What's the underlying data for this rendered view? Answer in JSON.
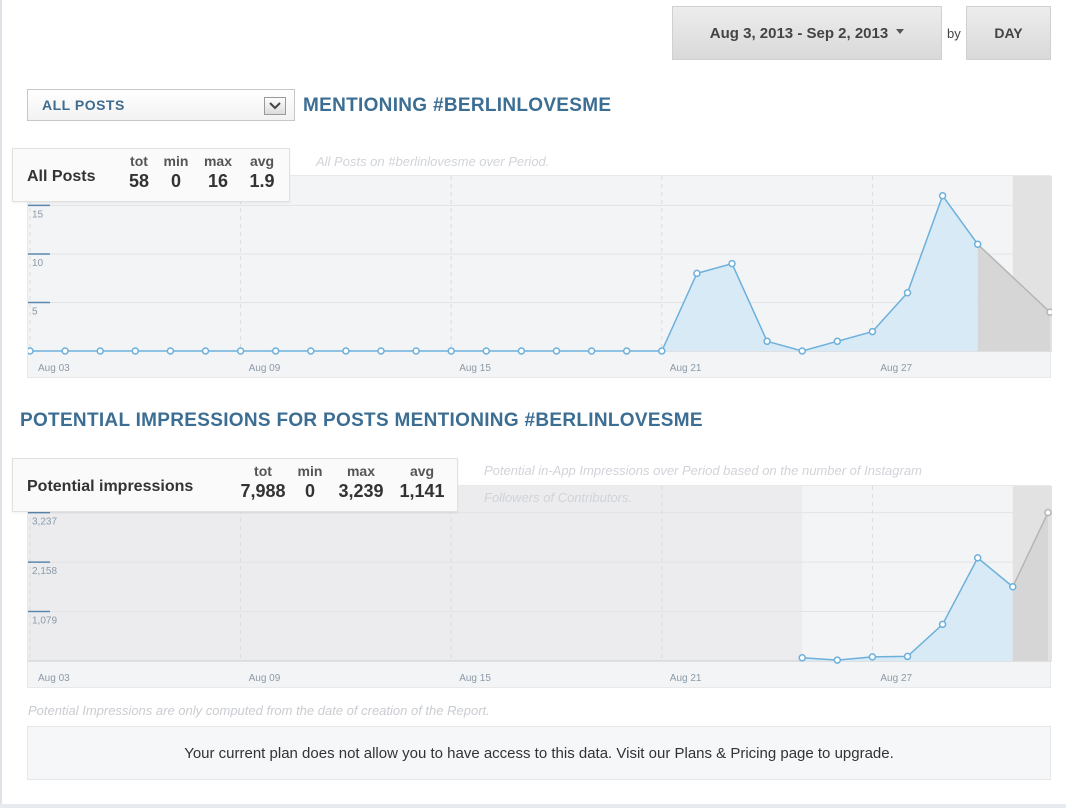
{
  "toolbar": {
    "date_range": "Aug 3, 2013 - Sep 2, 2013",
    "by_label": "by",
    "granularity": "DAY"
  },
  "filter": {
    "selected": "ALL POSTS",
    "heading": "MENTIONING #BERLINLOVESME"
  },
  "posts_panel": {
    "stats_name": "All Posts",
    "headers": [
      "tot",
      "min",
      "max",
      "avg"
    ],
    "values": [
      "58",
      "0",
      "16",
      "1.9"
    ],
    "subtitle": "All Posts on #berlinlovesme over Period."
  },
  "impressions_panel": {
    "heading": "POTENTIAL IMPRESSIONS FOR POSTS MENTIONING #BERLINLOVESME",
    "stats_name": "Potential impressions",
    "headers": [
      "tot",
      "min",
      "max",
      "avg"
    ],
    "values": [
      "7,988",
      "0",
      "3,239",
      "1,141"
    ],
    "subtitle_line1": "Potential in-App Impressions over Period based on the number of Instagram",
    "subtitle_line2": "Followers of Contributors."
  },
  "footer": {
    "note": "Potential Impressions are only computed from the date of creation of the Report.",
    "plan_message": "Your current plan does not allow you to have access to this data. Visit our Plans & Pricing page to upgrade."
  },
  "colors": {
    "line": "#6cb0db",
    "fill": "#d8eaf6",
    "projection": "#b5b5b5",
    "accent": "#3c6e94"
  },
  "chart_data": [
    {
      "type": "area",
      "x_ticks": [
        "Aug 03",
        "Aug 09",
        "Aug 15",
        "Aug 21",
        "Aug 27"
      ],
      "y_ticks": [
        "5",
        "10",
        "15"
      ],
      "ylim": [
        0,
        17
      ],
      "grid": true,
      "x": [
        "Aug 03",
        "Aug 04",
        "Aug 05",
        "Aug 06",
        "Aug 07",
        "Aug 08",
        "Aug 09",
        "Aug 10",
        "Aug 11",
        "Aug 12",
        "Aug 13",
        "Aug 14",
        "Aug 15",
        "Aug 16",
        "Aug 17",
        "Aug 18",
        "Aug 19",
        "Aug 20",
        "Aug 21",
        "Aug 22",
        "Aug 23",
        "Aug 24",
        "Aug 25",
        "Aug 26",
        "Aug 27",
        "Aug 28",
        "Aug 29",
        "Aug 30",
        "Aug 31",
        "Sep 01"
      ],
      "values": [
        0,
        0,
        0,
        0,
        0,
        0,
        0,
        0,
        0,
        0,
        0,
        0,
        0,
        0,
        0,
        0,
        0,
        0,
        0,
        8,
        9,
        1,
        0,
        1,
        2,
        6,
        16,
        11,
        null,
        4
      ],
      "projection_from": 27
    },
    {
      "type": "area",
      "x_ticks": [
        "Aug 03",
        "Aug 09",
        "Aug 15",
        "Aug 21",
        "Aug 27"
      ],
      "y_ticks": [
        "1,079",
        "2,158",
        "3,237"
      ],
      "ylim": [
        0,
        3600
      ],
      "grid": true,
      "x": [
        "Aug 25",
        "Aug 26",
        "Aug 27",
        "Aug 28",
        "Aug 29",
        "Aug 30",
        "Aug 31",
        "Sep 01",
        "Sep 02"
      ],
      "values": [
        70,
        20,
        90,
        100,
        800,
        2250,
        1620,
        null,
        3239
      ],
      "start_index": 22,
      "projection_from": 6
    }
  ]
}
